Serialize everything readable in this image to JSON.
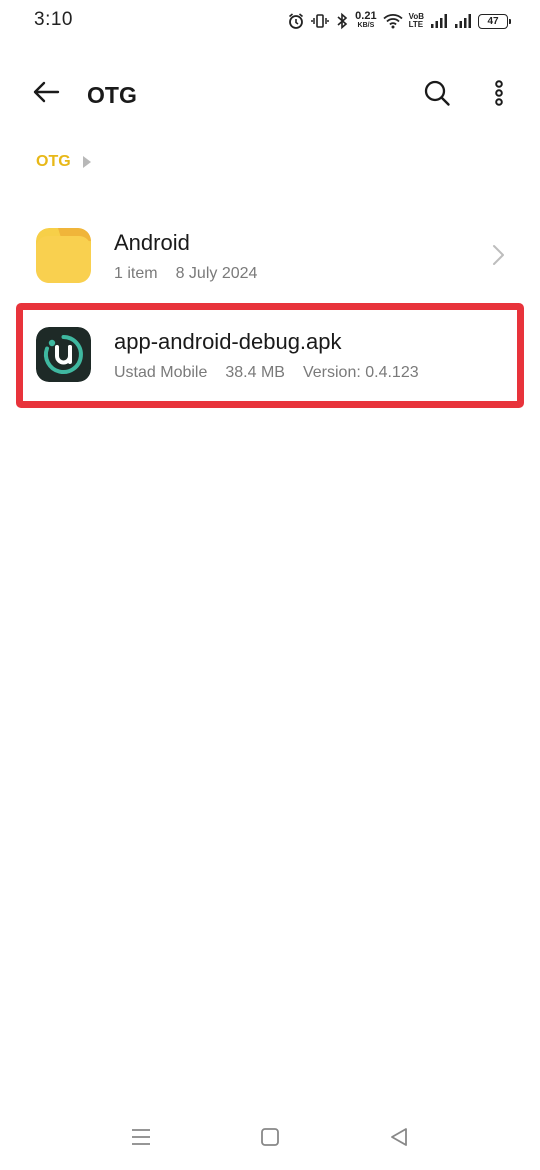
{
  "status_bar": {
    "time": "3:10",
    "net_speed_value": "0.21",
    "net_speed_unit": "KB/S",
    "volte_top": "VoB",
    "volte_bottom": "LTE",
    "battery": "47",
    "icons": [
      "alarm-icon",
      "vibrate-icon",
      "bluetooth-icon",
      "wifi-icon",
      "signal-icon",
      "signal-icon",
      "battery-icon"
    ]
  },
  "toolbar": {
    "title": "OTG",
    "icons": [
      "back-arrow-icon",
      "search-icon",
      "more-vert-icon"
    ]
  },
  "breadcrumb": {
    "items": [
      "OTG"
    ]
  },
  "files": [
    {
      "name": "Android",
      "type": "folder",
      "meta": [
        "1 item",
        "8 July 2024"
      ],
      "icon": "folder-icon"
    },
    {
      "name": "app-android-debug.apk",
      "type": "apk",
      "meta": [
        "Ustad Mobile",
        "38.4 MB",
        "Version: 0.4.123"
      ],
      "icon": "ustad-app-icon"
    }
  ],
  "nav_bar": {
    "icons": [
      "menu-icon",
      "home-icon",
      "back-icon"
    ]
  },
  "colors": {
    "accent": "#e8b818",
    "folder": "#f7cf48",
    "highlight": "#e8333b",
    "apk_icon_bg": "#1e2a27",
    "apk_icon_fg": "#3fb8a0"
  }
}
